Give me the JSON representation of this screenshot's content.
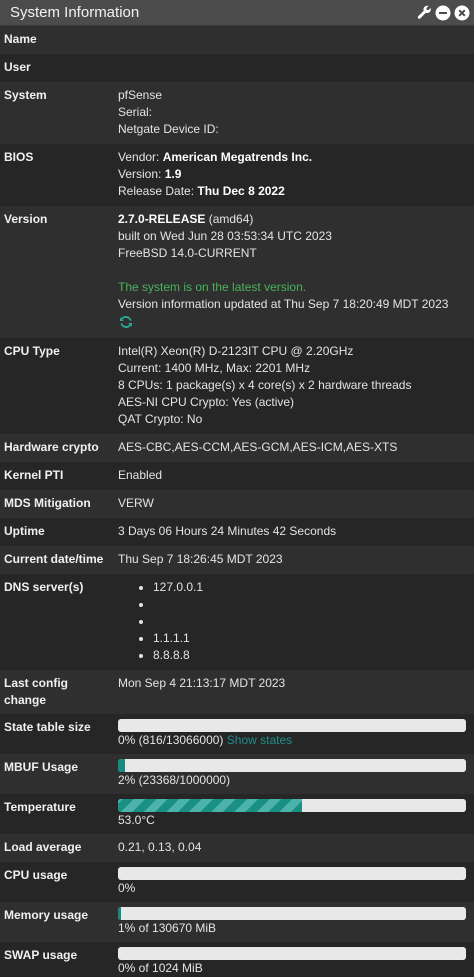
{
  "panel": {
    "title": "System Information",
    "icons": [
      "wrench-icon",
      "minimize-icon",
      "close-icon"
    ]
  },
  "labels": {
    "name": "Name",
    "user": "User",
    "system": "System",
    "bios": "BIOS",
    "version": "Version",
    "cpu_type": "CPU Type",
    "hw_crypto": "Hardware crypto",
    "kernel_pti": "Kernel PTI",
    "mds": "MDS Mitigation",
    "uptime": "Uptime",
    "datetime": "Current date/time",
    "dns": "DNS server(s)",
    "last_config_1": "Last config",
    "last_config_2": "change",
    "state_table": "State table size",
    "mbuf": "MBUF Usage",
    "temperature": "Temperature",
    "load_avg": "Load average",
    "cpu_usage": "CPU usage",
    "memory": "Memory usage",
    "swap": "SWAP usage"
  },
  "system": {
    "platform": "pfSense",
    "serial": "Serial:",
    "device_id": "Netgate Device ID:"
  },
  "bios": {
    "vendor_label": "Vendor: ",
    "vendor": "American Megatrends Inc.",
    "version_label": "Version: ",
    "version": "1.9",
    "release_label": "Release Date: ",
    "release": "Thu Dec 8 2022"
  },
  "version": {
    "release": "2.7.0-RELEASE",
    "arch": " (amd64)",
    "built": "built on Wed Jun 28 03:53:34 UTC 2023",
    "os": "FreeBSD 14.0-CURRENT",
    "status": "The system is on the latest version.",
    "updated": "Version information updated at Thu Sep 7 18:20:49 MDT 2023",
    "refresh_icon": "refresh-icon"
  },
  "cpu": {
    "model": "Intel(R) Xeon(R) D-2123IT CPU @ 2.20GHz",
    "freq": "Current: 1400 MHz, Max: 2201 MHz",
    "cores": "8 CPUs: 1 package(s) x 4 core(s) x 2 hardware threads",
    "aesni": "AES-NI CPU Crypto: Yes (active)",
    "qat": "QAT Crypto: No"
  },
  "hw_crypto": "AES-CBC,AES-CCM,AES-GCM,AES-ICM,AES-XTS",
  "kernel_pti": "Enabled",
  "mds": "VERW",
  "uptime": "3 Days 06 Hours 24 Minutes 42 Seconds",
  "datetime": "Thu Sep 7 18:26:45 MDT 2023",
  "dns_servers": [
    "127.0.0.1",
    "",
    "",
    "1.1.1.1",
    "8.8.8.8"
  ],
  "last_config": "Mon Sep 4 21:13:17 MDT 2023",
  "state_table": {
    "text": "0% (816/13066000)",
    "link": "Show states",
    "percent": 0
  },
  "mbuf": {
    "text": "2% (23368/1000000)",
    "percent": 2
  },
  "temperature": {
    "text": "53.0°C",
    "percent": 53
  },
  "load_avg": "0.21, 0.13, 0.04",
  "cpu_usage": {
    "text": "0%",
    "percent": 0
  },
  "memory": {
    "text": "1% of 130670 MiB",
    "percent": 1
  },
  "swap": {
    "text": "0% of 1024 MiB",
    "percent": 0
  },
  "colors": {
    "bar_fill": "#178a80",
    "bar_track": "#e8e8e8",
    "status_green": "#49b35c",
    "link": "#1f8f8a"
  }
}
